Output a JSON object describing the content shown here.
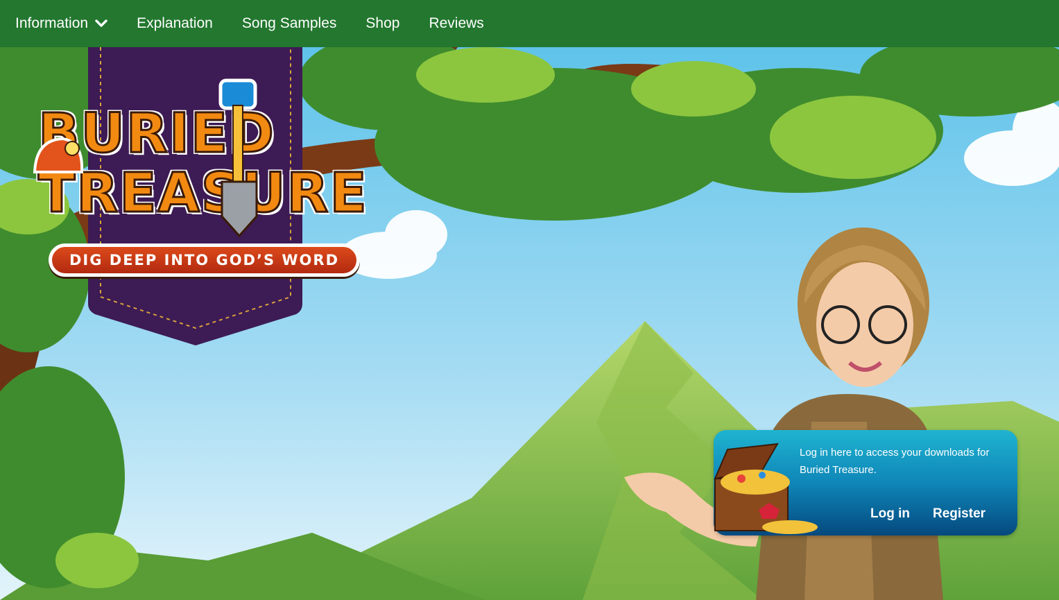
{
  "nav": {
    "items": [
      {
        "label": "Information",
        "has_dropdown": true
      },
      {
        "label": "Explanation"
      },
      {
        "label": "Song Samples"
      },
      {
        "label": "Shop"
      },
      {
        "label": "Reviews"
      }
    ],
    "dropdown_icon": "chevron-down-icon"
  },
  "logo": {
    "title_line1": "BURIED",
    "title_line2": "TREASURE",
    "tagline": "DIG DEEP INTO GOD’S WORD"
  },
  "login": {
    "message": "Log in here to access your downloads for Buried Treasure.",
    "login_label": "Log in",
    "register_label": "Register"
  },
  "colors": {
    "nav_bg": "#23772f",
    "banner": "#3d1b55",
    "card_top": "#1fb4d0",
    "card_bottom": "#05497e"
  }
}
